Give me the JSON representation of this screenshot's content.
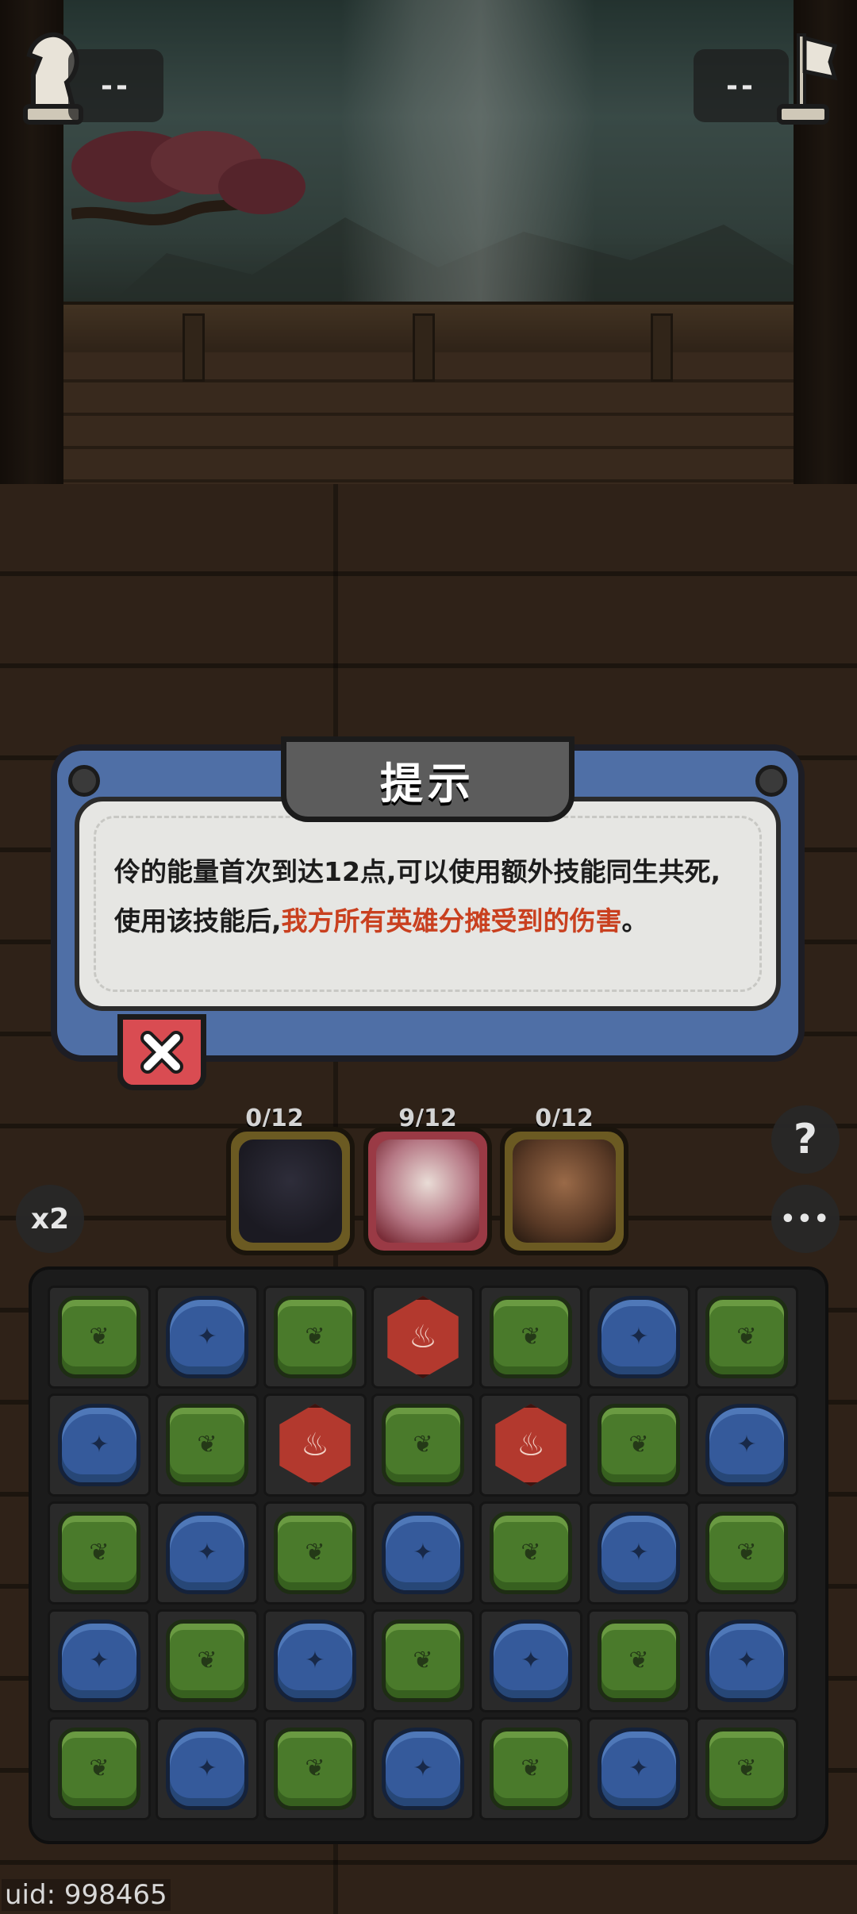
{
  "hud": {
    "left_score": "--",
    "right_score": "--",
    "left_icon": "knight-chess-icon",
    "right_icon": "flag-icon"
  },
  "dialog": {
    "title": "提示",
    "text_prefix": "伶的能量首次到达12点,可以使用额外技能同生共死,使用该技能后,",
    "text_highlight": "我方所有英雄分摊受到的伤害",
    "text_suffix": "。",
    "close_icon": "close-x-icon",
    "highlight_color": "#c9401f"
  },
  "heroes": [
    {
      "energy": "0/12",
      "name_icon": "hero-portrait-dark-hair"
    },
    {
      "energy": "9/12",
      "name_icon": "hero-portrait-white-hair"
    },
    {
      "energy": "0/12",
      "name_icon": "hero-portrait-curly-hair"
    }
  ],
  "controls": {
    "speed_label": "x2",
    "help_label": "?",
    "more_label": "•••"
  },
  "board": {
    "rows": [
      [
        "green",
        "blue",
        "green",
        "red",
        "green",
        "blue",
        "green"
      ],
      [
        "blue",
        "green",
        "red",
        "green",
        "red",
        "green",
        "blue"
      ],
      [
        "green",
        "blue",
        "green",
        "blue",
        "green",
        "blue",
        "green"
      ],
      [
        "blue",
        "green",
        "blue",
        "green",
        "blue",
        "green",
        "blue"
      ],
      [
        "green",
        "blue",
        "green",
        "blue",
        "green",
        "blue",
        "green"
      ]
    ]
  },
  "uid_text": "uid: 998465"
}
